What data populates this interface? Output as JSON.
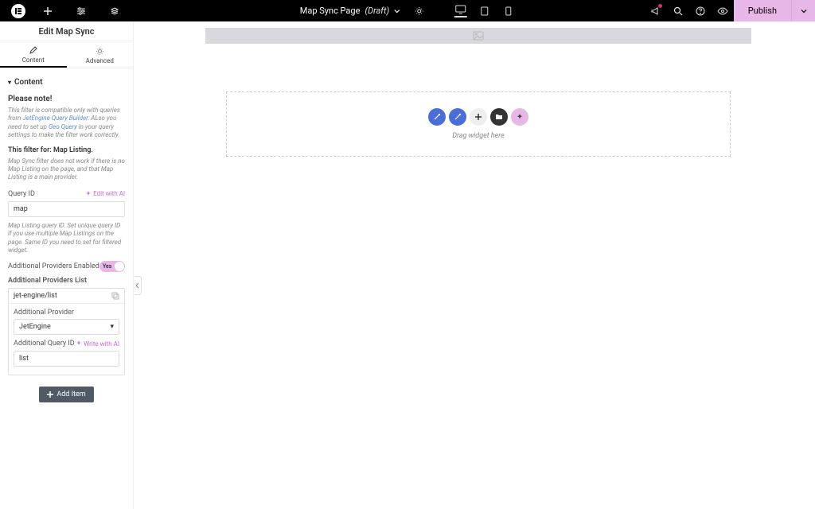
{
  "topbar": {
    "page": "Map Sync Page",
    "status": "(Draft)",
    "publish": "Publish"
  },
  "sidebar": {
    "title": "Edit Map Sync",
    "tabs": {
      "content": "Content",
      "advanced": "Advanced"
    },
    "section": "Content",
    "please_note": "Please note!",
    "help_pre": "This filter is compatible only with queries from ",
    "help_link1": "JetEngine Query Builder",
    "help_mid": ". ALso you need to set up ",
    "help_link2": "Geo Query",
    "help_post": " in your query settings to make the filter work correctly.",
    "filter_for": "This filter for: Map Listing.",
    "filter_note": "Map Sync filter does not work if there is no Map Listing on the page, and that Map Listing is a main provider.",
    "query_id_label": "Query ID",
    "edit_ai": "Edit with AI",
    "query_id_value": "map",
    "query_id_help": "Map Listing query ID. Set unique query ID if you use multiple Map Listings on the page. Same ID you need to set for filtered widget.",
    "add_prov_enabled": "Additional Providers Enabled",
    "toggle_yes": "Yes",
    "add_prov_list": "Additional Providers List",
    "repeater": {
      "title": "jet-engine/list",
      "provider_label": "Additional Provider",
      "provider_value": "JetEngine",
      "query_label": "Additional Query ID",
      "write_ai": "Write with AI",
      "query_value": "list"
    },
    "add_item": "Add Item"
  },
  "canvas": {
    "hint": "Drag widget here"
  }
}
